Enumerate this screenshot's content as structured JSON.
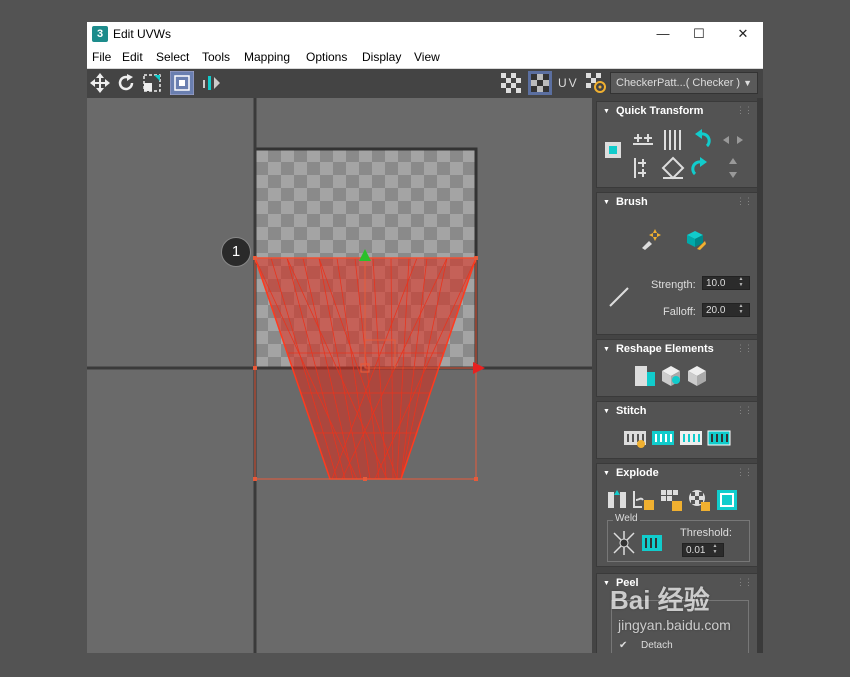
{
  "window": {
    "title": "Edit UVWs",
    "app_icon": "3",
    "minimize": "—",
    "maximize": "☐",
    "close": "✕"
  },
  "menu": [
    "File",
    "Edit",
    "Select",
    "Tools",
    "Mapping",
    "Options",
    "Display",
    "View"
  ],
  "toolbar": {
    "left_icons": [
      "move-icon",
      "rotate-icon",
      "scale-icon",
      "freeform-icon",
      "mirror-icon"
    ],
    "right_icons": [
      "checker-toggle-icon",
      "checker-map-icon",
      "uv-channel-icon",
      "texture-settings-icon"
    ],
    "uv_label": "UV",
    "texture_dropdown": "CheckerPatt...( Checker )"
  },
  "viewport": {
    "callout_number": "1",
    "colors": {
      "selection": "#e02a1a",
      "gizmo_x": "#e82020",
      "gizmo_y": "#2ac02a"
    }
  },
  "panel": {
    "quick_transform": {
      "title": "Quick Transform"
    },
    "brush": {
      "title": "Brush",
      "strength_label": "Strength:",
      "strength_value": "10.0",
      "falloff_label": "Falloff:",
      "falloff_value": "20.0"
    },
    "reshape": {
      "title": "Reshape Elements"
    },
    "stitch": {
      "title": "Stitch"
    },
    "explode": {
      "title": "Explode",
      "weld_label": "Weld",
      "threshold_label": "Threshold:",
      "threshold_value": "0.01"
    },
    "peel": {
      "title": "Peel",
      "detach_label": "Detach"
    }
  },
  "watermark": {
    "text": "Bai 经验",
    "url": "jingyan.baidu.com"
  }
}
